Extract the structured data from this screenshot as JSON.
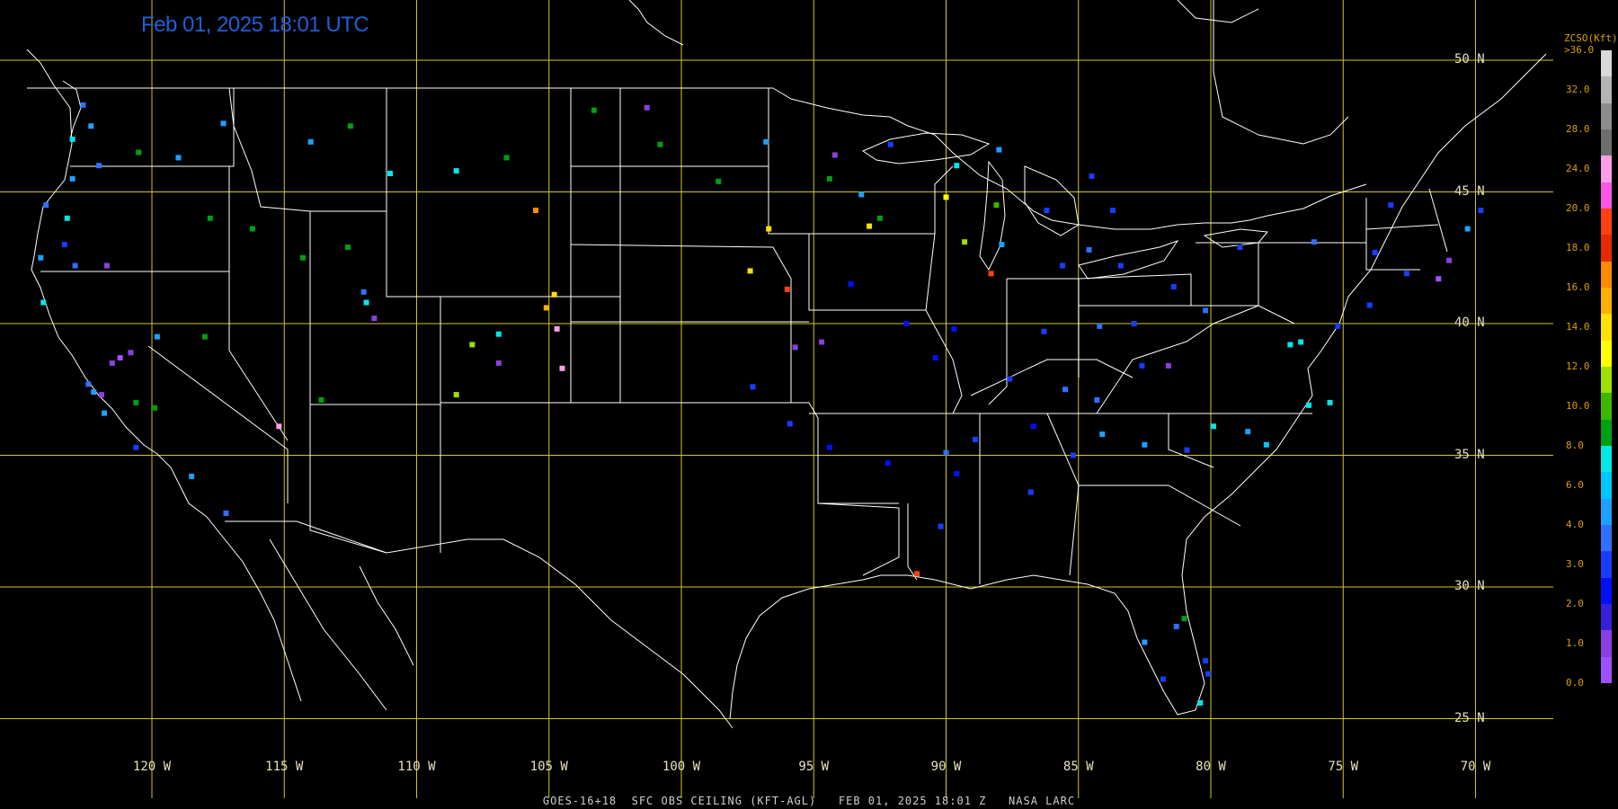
{
  "timestamp": "Feb 01, 2025 18:01 UTC",
  "footer": "GOES-16+18  SFC OBS CEILING (KFT-AGL)   FEB 01, 2025 18:01 Z   NASA LARC",
  "lat_labels": [
    "50 N",
    "45 N",
    "40 N",
    "35 N",
    "30 N",
    "25 N"
  ],
  "lon_labels": [
    "120 W",
    "115 W",
    "110 W",
    "105 W",
    "100 W",
    "95 W",
    "90 W",
    "85 W",
    "80 W",
    "75 W",
    "70 W"
  ],
  "legend": {
    "title": "ZCSO(Kft)",
    "top_label": ">36.0",
    "ticks": [
      "32.0",
      "28.0",
      "24.0",
      "20.0",
      "18.0",
      "16.0",
      "14.0",
      "12.0",
      "10.0",
      "8.0",
      "6.0",
      "4.0",
      "3.0",
      "2.0",
      "1.0",
      "0.0"
    ],
    "colors": [
      "#d9d9d9",
      "#b4b4b4",
      "#8c8c8c",
      "#6e6e6e",
      "#ff9ee8",
      "#ff55e6",
      "#ff4010",
      "#e32a00",
      "#ff8c00",
      "#ffb000",
      "#ffe100",
      "#ffff00",
      "#9ee000",
      "#3ab800",
      "#00a010",
      "#00e8e8",
      "#00c8ff",
      "#1ea0ff",
      "#3070ff",
      "#1a3cff",
      "#0010ff",
      "#3820d8",
      "#8a40e0",
      "#a050ff"
    ],
    "grid_color": "#d4c81a",
    "coast_color": "#ffffff"
  },
  "observations": [
    {
      "lon": -122.3,
      "lat": 47.5,
      "c": "#1ea0ff"
    },
    {
      "lon": -122.6,
      "lat": 48.3,
      "c": "#3070ff"
    },
    {
      "lon": -123.0,
      "lat": 47.0,
      "c": "#00e8e8"
    },
    {
      "lon": -122.0,
      "lat": 46.0,
      "c": "#3070ff"
    },
    {
      "lon": -123.0,
      "lat": 45.5,
      "c": "#1ea0ff"
    },
    {
      "lon": -124.0,
      "lat": 44.5,
      "c": "#3070ff"
    },
    {
      "lon": -123.2,
      "lat": 44.0,
      "c": "#00e8e8"
    },
    {
      "lon": -123.3,
      "lat": 43.0,
      "c": "#1a3cff"
    },
    {
      "lon": -124.2,
      "lat": 42.5,
      "c": "#1ea0ff"
    },
    {
      "lon": -122.9,
      "lat": 42.2,
      "c": "#3070ff"
    },
    {
      "lon": -121.7,
      "lat": 42.2,
      "c": "#8a40e0"
    },
    {
      "lon": -124.1,
      "lat": 40.8,
      "c": "#00e8e8"
    },
    {
      "lon": -122.4,
      "lat": 37.7,
      "c": "#3070ff"
    },
    {
      "lon": -122.2,
      "lat": 37.4,
      "c": "#1ea0ff"
    },
    {
      "lon": -121.9,
      "lat": 37.3,
      "c": "#8a40e0"
    },
    {
      "lon": -121.5,
      "lat": 38.5,
      "c": "#8a40e0"
    },
    {
      "lon": -121.2,
      "lat": 38.7,
      "c": "#a050ff"
    },
    {
      "lon": -120.8,
      "lat": 38.9,
      "c": "#8a40e0"
    },
    {
      "lon": -121.8,
      "lat": 36.6,
      "c": "#1ea0ff"
    },
    {
      "lon": -120.6,
      "lat": 37.0,
      "c": "#00a010"
    },
    {
      "lon": -119.9,
      "lat": 36.8,
      "c": "#00a010"
    },
    {
      "lon": -120.6,
      "lat": 35.3,
      "c": "#1a3cff"
    },
    {
      "lon": -118.5,
      "lat": 34.2,
      "c": "#1ea0ff"
    },
    {
      "lon": -117.2,
      "lat": 32.8,
      "c": "#3070ff"
    },
    {
      "lon": -117.3,
      "lat": 47.6,
      "c": "#1ea0ff"
    },
    {
      "lon": -119.0,
      "lat": 46.3,
      "c": "#1ea0ff"
    },
    {
      "lon": -120.5,
      "lat": 46.5,
      "c": "#00a010"
    },
    {
      "lon": -116.2,
      "lat": 43.6,
      "c": "#00a010"
    },
    {
      "lon": -114.3,
      "lat": 42.5,
      "c": "#00a010"
    },
    {
      "lon": -112.6,
      "lat": 42.9,
      "c": "#00a010"
    },
    {
      "lon": -111.9,
      "lat": 40.8,
      "c": "#00e8e8"
    },
    {
      "lon": -112.0,
      "lat": 41.2,
      "c": "#3070ff"
    },
    {
      "lon": -111.6,
      "lat": 40.2,
      "c": "#8a40e0"
    },
    {
      "lon": -113.6,
      "lat": 37.1,
      "c": "#00a010"
    },
    {
      "lon": -115.2,
      "lat": 36.1,
      "c": "#ff9ee8"
    },
    {
      "lon": -118.0,
      "lat": 39.5,
      "c": "#00a010"
    },
    {
      "lon": -119.8,
      "lat": 39.5,
      "c": "#1ea0ff"
    },
    {
      "lon": -117.8,
      "lat": 44.0,
      "c": "#00a010"
    },
    {
      "lon": -114.0,
      "lat": 46.9,
      "c": "#1ea0ff"
    },
    {
      "lon": -111.0,
      "lat": 45.7,
      "c": "#00e8e8"
    },
    {
      "lon": -108.5,
      "lat": 45.8,
      "c": "#00e8e8"
    },
    {
      "lon": -112.5,
      "lat": 47.5,
      "c": "#00a010"
    },
    {
      "lon": -106.6,
      "lat": 46.3,
      "c": "#00a010"
    },
    {
      "lon": -104.8,
      "lat": 41.1,
      "c": "#ffe100"
    },
    {
      "lon": -105.5,
      "lat": 44.3,
      "c": "#ff8c00"
    },
    {
      "lon": -104.7,
      "lat": 39.8,
      "c": "#ff9ee8"
    },
    {
      "lon": -104.5,
      "lat": 38.3,
      "c": "#ff9ee8"
    },
    {
      "lon": -105.1,
      "lat": 40.6,
      "c": "#ffb000"
    },
    {
      "lon": -106.9,
      "lat": 39.6,
      "c": "#00e8e8"
    },
    {
      "lon": -107.9,
      "lat": 39.2,
      "c": "#9ee000"
    },
    {
      "lon": -108.5,
      "lat": 37.3,
      "c": "#9ee000"
    },
    {
      "lon": -106.9,
      "lat": 38.5,
      "c": "#8a40e0"
    },
    {
      "lon": -103.3,
      "lat": 48.1,
      "c": "#00a010"
    },
    {
      "lon": -100.8,
      "lat": 46.8,
      "c": "#00a010"
    },
    {
      "lon": -101.3,
      "lat": 48.2,
      "c": "#8a40e0"
    },
    {
      "lon": -98.6,
      "lat": 45.4,
      "c": "#00a010"
    },
    {
      "lon": -96.8,
      "lat": 46.9,
      "c": "#1ea0ff"
    },
    {
      "lon": -96.7,
      "lat": 43.6,
      "c": "#ffe100"
    },
    {
      "lon": -97.4,
      "lat": 42.0,
      "c": "#ffe100"
    },
    {
      "lon": -96.0,
      "lat": 41.3,
      "c": "#ff4010"
    },
    {
      "lon": -95.9,
      "lat": 36.2,
      "c": "#1a3cff"
    },
    {
      "lon": -97.3,
      "lat": 37.6,
      "c": "#1a3cff"
    },
    {
      "lon": -95.7,
      "lat": 39.1,
      "c": "#8a40e0"
    },
    {
      "lon": -94.7,
      "lat": 39.3,
      "c": "#8a40e0"
    },
    {
      "lon": -93.2,
      "lat": 44.9,
      "c": "#1ea0ff"
    },
    {
      "lon": -94.4,
      "lat": 45.5,
      "c": "#00a010"
    },
    {
      "lon": -92.5,
      "lat": 44.0,
      "c": "#00a010"
    },
    {
      "lon": -93.6,
      "lat": 41.5,
      "c": "#0010ff"
    },
    {
      "lon": -91.5,
      "lat": 40.0,
      "c": "#0010ff"
    },
    {
      "lon": -90.4,
      "lat": 38.7,
      "c": "#0010ff"
    },
    {
      "lon": -89.7,
      "lat": 39.8,
      "c": "#0010ff"
    },
    {
      "lon": -88.3,
      "lat": 41.9,
      "c": "#ff4010"
    },
    {
      "lon": -87.9,
      "lat": 43.0,
      "c": "#1ea0ff"
    },
    {
      "lon": -89.3,
      "lat": 43.1,
      "c": "#9ee000"
    },
    {
      "lon": -88.1,
      "lat": 44.5,
      "c": "#3ab800"
    },
    {
      "lon": -89.6,
      "lat": 46.0,
      "c": "#00e8e8"
    },
    {
      "lon": -90.0,
      "lat": 44.8,
      "c": "#ffff00"
    },
    {
      "lon": -85.6,
      "lat": 42.2,
      "c": "#1a3cff"
    },
    {
      "lon": -84.6,
      "lat": 42.8,
      "c": "#3070ff"
    },
    {
      "lon": -83.4,
      "lat": 42.2,
      "c": "#1a3cff"
    },
    {
      "lon": -86.3,
      "lat": 39.7,
      "c": "#1a3cff"
    },
    {
      "lon": -84.2,
      "lat": 39.9,
      "c": "#3070ff"
    },
    {
      "lon": -82.9,
      "lat": 40.0,
      "c": "#1a3cff"
    },
    {
      "lon": -81.4,
      "lat": 41.4,
      "c": "#1a3cff"
    },
    {
      "lon": -80.2,
      "lat": 40.5,
      "c": "#3070ff"
    },
    {
      "lon": -77.0,
      "lat": 39.2,
      "c": "#00e8e8"
    },
    {
      "lon": -76.6,
      "lat": 39.3,
      "c": "#00e8e8"
    },
    {
      "lon": -78.9,
      "lat": 42.9,
      "c": "#1a3cff"
    },
    {
      "lon": -76.1,
      "lat": 43.1,
      "c": "#3070ff"
    },
    {
      "lon": -73.8,
      "lat": 42.7,
      "c": "#1a3cff"
    },
    {
      "lon": -73.2,
      "lat": 44.5,
      "c": "#1a3cff"
    },
    {
      "lon": -71.0,
      "lat": 42.4,
      "c": "#8a40e0"
    },
    {
      "lon": -71.4,
      "lat": 41.7,
      "c": "#a050ff"
    },
    {
      "lon": -70.3,
      "lat": 43.6,
      "c": "#1ea0ff"
    },
    {
      "lon": -69.8,
      "lat": 44.3,
      "c": "#1a3cff"
    },
    {
      "lon": -72.6,
      "lat": 41.9,
      "c": "#1a3cff"
    },
    {
      "lon": -78.6,
      "lat": 35.9,
      "c": "#1ea0ff"
    },
    {
      "lon": -77.9,
      "lat": 35.4,
      "c": "#00c8ff"
    },
    {
      "lon": -79.9,
      "lat": 36.1,
      "c": "#00e8e8"
    },
    {
      "lon": -80.9,
      "lat": 35.2,
      "c": "#1a3cff"
    },
    {
      "lon": -82.5,
      "lat": 35.4,
      "c": "#1ea0ff"
    },
    {
      "lon": -84.1,
      "lat": 35.8,
      "c": "#1ea0ff"
    },
    {
      "lon": -86.7,
      "lat": 36.1,
      "c": "#0010ff"
    },
    {
      "lon": -85.2,
      "lat": 35.0,
      "c": "#1a3cff"
    },
    {
      "lon": -88.9,
      "lat": 35.6,
      "c": "#1a3cff"
    },
    {
      "lon": -90.0,
      "lat": 35.1,
      "c": "#3070ff"
    },
    {
      "lon": -89.6,
      "lat": 34.3,
      "c": "#0010ff"
    },
    {
      "lon": -92.2,
      "lat": 34.7,
      "c": "#0010ff"
    },
    {
      "lon": -94.4,
      "lat": 35.3,
      "c": "#0010ff"
    },
    {
      "lon": -90.2,
      "lat": 32.3,
      "c": "#1a3cff"
    },
    {
      "lon": -86.8,
      "lat": 33.6,
      "c": "#1a3cff"
    },
    {
      "lon": -91.1,
      "lat": 30.5,
      "c": "#ff4010"
    },
    {
      "lon": -82.5,
      "lat": 27.9,
      "c": "#1ea0ff"
    },
    {
      "lon": -81.3,
      "lat": 28.5,
      "c": "#3070ff"
    },
    {
      "lon": -80.2,
      "lat": 27.2,
      "c": "#1a3cff"
    },
    {
      "lon": -81.8,
      "lat": 26.5,
      "c": "#1a3cff"
    },
    {
      "lon": -80.1,
      "lat": 26.7,
      "c": "#1a3cff"
    },
    {
      "lon": -80.4,
      "lat": 25.6,
      "c": "#00e8e8"
    },
    {
      "lon": -81.0,
      "lat": 28.8,
      "c": "#00a010"
    },
    {
      "lon": -75.5,
      "lat": 37.0,
      "c": "#00e8e8"
    },
    {
      "lon": -76.3,
      "lat": 36.9,
      "c": "#00e8e8"
    },
    {
      "lon": -74.0,
      "lat": 40.7,
      "c": "#1a3cff"
    },
    {
      "lon": -75.2,
      "lat": 39.9,
      "c": "#1a3cff"
    },
    {
      "lon": -88.0,
      "lat": 46.6,
      "c": "#1ea0ff"
    },
    {
      "lon": -92.1,
      "lat": 46.8,
      "c": "#1a3cff"
    },
    {
      "lon": -94.2,
      "lat": 46.4,
      "c": "#8a40e0"
    },
    {
      "lon": -92.9,
      "lat": 43.7,
      "c": "#ffe100"
    },
    {
      "lon": -84.5,
      "lat": 45.6,
      "c": "#1a3cff"
    },
    {
      "lon": -86.2,
      "lat": 44.3,
      "c": "#1a3cff"
    },
    {
      "lon": -83.7,
      "lat": 44.3,
      "c": "#1a3cff"
    },
    {
      "lon": -85.5,
      "lat": 37.5,
      "c": "#3070ff"
    },
    {
      "lon": -84.3,
      "lat": 37.1,
      "c": "#3070ff"
    },
    {
      "lon": -82.6,
      "lat": 38.4,
      "c": "#1a3cff"
    },
    {
      "lon": -81.6,
      "lat": 38.4,
      "c": "#8a40e0"
    },
    {
      "lon": -87.6,
      "lat": 37.9,
      "c": "#1a3cff"
    }
  ]
}
